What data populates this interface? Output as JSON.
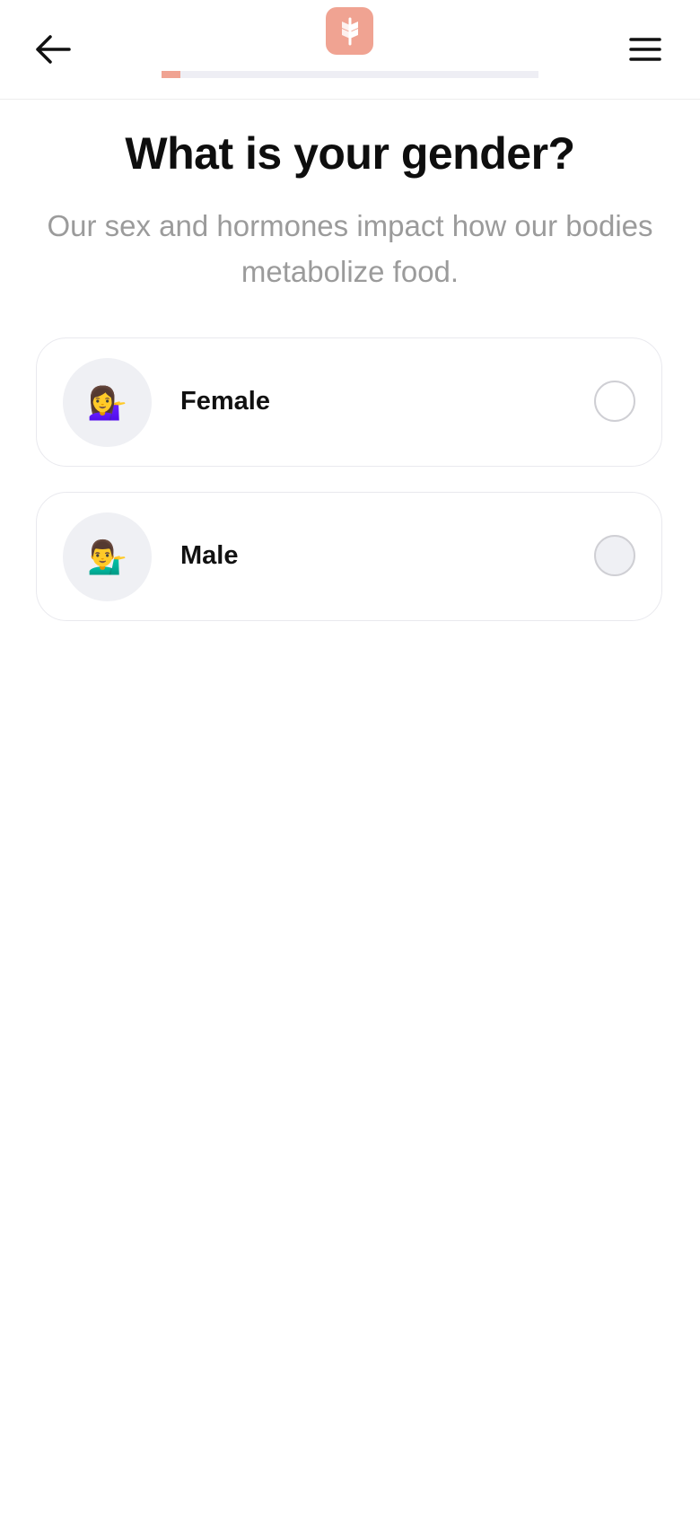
{
  "header": {
    "back_icon": "arrow-left-icon",
    "menu_icon": "hamburger-menu-icon",
    "logo_icon": "wheat-logo-icon",
    "progress": 0.05
  },
  "colors": {
    "brand": "#f0a392",
    "progress_fill": "#f0a392",
    "progress_track": "#eeeef4",
    "subtitle_text": "#9b9b9b"
  },
  "main": {
    "title": "What is your gender?",
    "subtitle": "Our sex and hormones impact how our bodies metabolize food."
  },
  "options": [
    {
      "label": "Female",
      "emoji": "💁‍♀️",
      "icon": "woman-tipping-hand-emoji",
      "selected": false
    },
    {
      "label": "Male",
      "emoji": "💁‍♂️",
      "icon": "man-tipping-hand-emoji",
      "selected": false
    }
  ]
}
